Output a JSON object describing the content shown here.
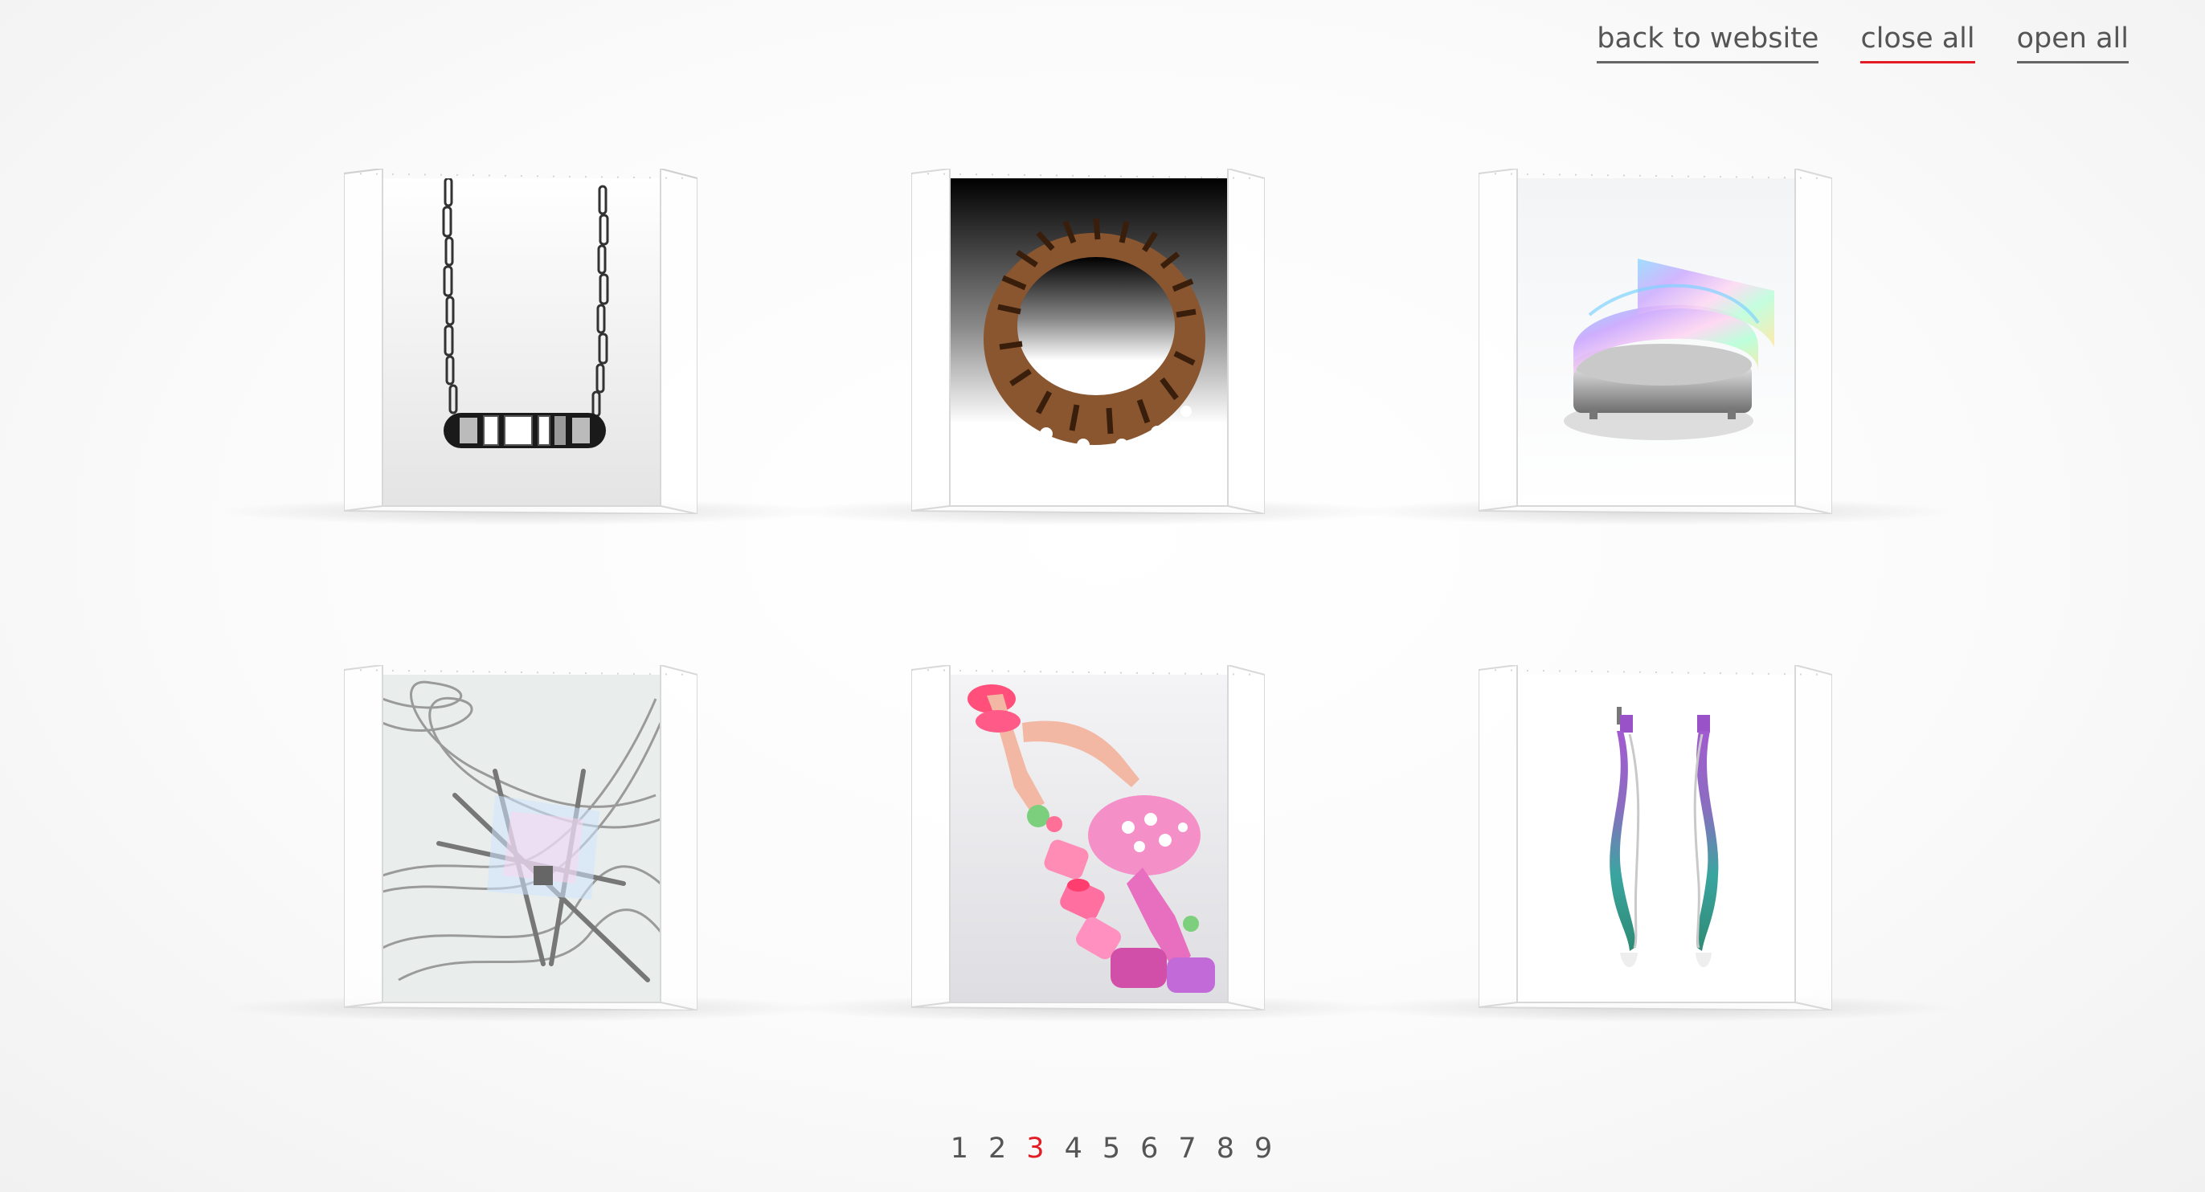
{
  "nav": {
    "back_label": "back to website",
    "close_label": "close all",
    "open_label": "open all"
  },
  "gallery": {
    "items": [
      {
        "icon": "chain-pendant-necklace-icon"
      },
      {
        "icon": "wooden-bangle-icon"
      },
      {
        "icon": "iridescent-ring-icon"
      },
      {
        "icon": "wire-brooch-icon"
      },
      {
        "icon": "pink-hands-necklace-icon"
      },
      {
        "icon": "drop-earrings-icon"
      }
    ]
  },
  "pagination": {
    "pages": [
      "1",
      "2",
      "3",
      "4",
      "5",
      "6",
      "7",
      "8",
      "9"
    ],
    "current": "3"
  },
  "colors": {
    "accent": "#e21b24",
    "text": "#555555"
  }
}
